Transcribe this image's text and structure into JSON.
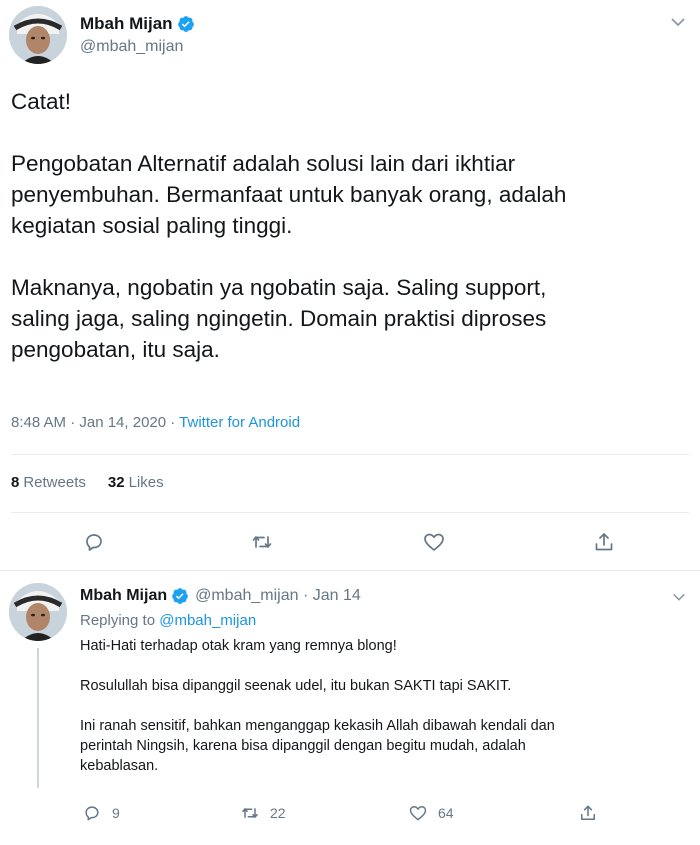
{
  "main_tweet": {
    "display_name": "Mbah Mijan",
    "handle": "@mbah_mijan",
    "text": "Catat!\n\nPengobatan Alternatif adalah solusi lain dari ikhtiar\npenyembuhan. Bermanfaat untuk banyak orang, adalah\nkegiatan sosial paling tinggi.\n\nMaknanya, ngobatin ya ngobatin saja. Saling support,\nsaling jaga, saling ngingetin. Domain praktisi diproses\npengobatan, itu saja.",
    "timestamp": "8:48 AM · Jan 14, 2020 · ",
    "source": "Twitter for Android",
    "retweets_count": "8",
    "retweets_label": "Retweets",
    "likes_count": "32",
    "likes_label": "Likes"
  },
  "reply_tweet": {
    "display_name": "Mbah Mijan",
    "handle_date": "@mbah_mijan · Jan 14",
    "replying_prefix": "Replying to ",
    "replying_to": "@mbah_mijan",
    "text": "Hati-Hati terhadap otak kram yang remnya blong!\n\nRosulullah bisa dipanggil seenak udel, itu bukan SAKTI tapi SAKIT.\n\nIni ranah sensitif, bahkan menganggap kekasih Allah dibawah kendali dan\nperintah Ningsih, karena bisa dipanggil dengan begitu mudah, adalah\nkebablasan.",
    "reply_count": "9",
    "retweet_count": "22",
    "like_count": "64"
  },
  "icons": {
    "verified": "verified-badge-icon",
    "caret": "chevron-down-icon",
    "reply": "reply-icon",
    "retweet": "retweet-icon",
    "like": "heart-icon",
    "share": "share-icon"
  },
  "colors": {
    "text": "#14171a",
    "secondary": "#657786",
    "link": "#1b95e0",
    "verified": "#1da1f2",
    "divider": "#e6ecf0"
  }
}
